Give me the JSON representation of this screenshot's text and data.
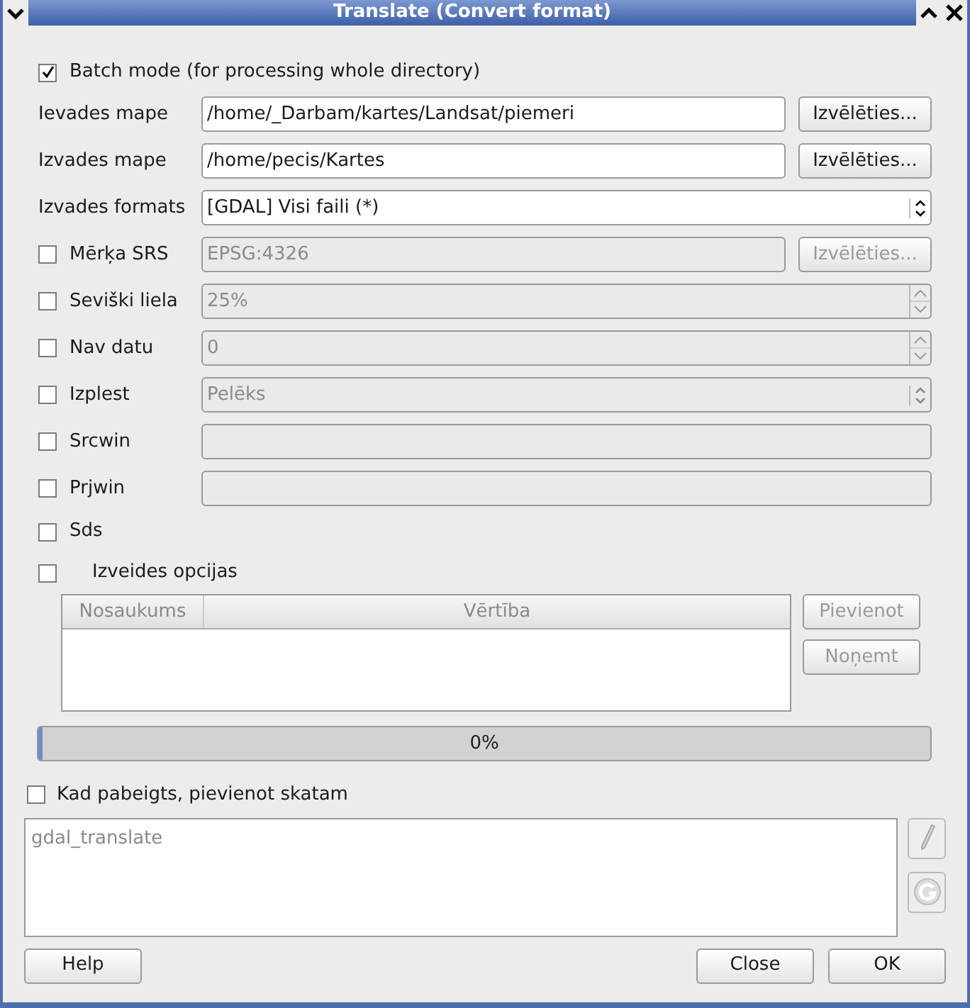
{
  "window": {
    "title": "Translate (Convert format)"
  },
  "batch_mode": {
    "label": "Batch mode (for processing whole directory)",
    "checked": true
  },
  "rows": [
    {
      "kind": "path",
      "label": "Ievades mape",
      "value": "/home/_Darbam/kartes/Landsat/piemeri",
      "button": "Izvēlēties...",
      "disabled": false
    },
    {
      "kind": "path",
      "label": "Izvades mape",
      "value": "/home/pecis/Kartes",
      "button": "Izvēlēties...",
      "disabled": false
    },
    {
      "kind": "combo",
      "label": "Izvades formats",
      "value": "[GDAL] Visi faili (*)",
      "disabled": false
    },
    {
      "kind": "path",
      "label": "Mērķa SRS",
      "checked": false,
      "value": "EPSG:4326",
      "button": "Izvēlēties...",
      "disabled": true
    },
    {
      "kind": "spin",
      "label": "Seviški liela",
      "checked": false,
      "value": "25%",
      "disabled": true
    },
    {
      "kind": "spin",
      "label": "Nav datu",
      "checked": false,
      "value": "0",
      "disabled": true
    },
    {
      "kind": "combo",
      "label": "Izplest",
      "checked": false,
      "value": "Pelēks",
      "disabled": true
    },
    {
      "kind": "text",
      "label": "Srcwin",
      "checked": false,
      "disabled": true
    },
    {
      "kind": "text",
      "label": "Prjwin",
      "checked": false,
      "disabled": true
    },
    {
      "kind": "check",
      "label": "Sds",
      "checked": false
    }
  ],
  "creation_options": {
    "label": "Izveides opcijas",
    "checked": false,
    "columns": [
      "Nosaukums",
      "Vērtība"
    ],
    "buttons": [
      {
        "label": "Pievienot",
        "disabled": true
      },
      {
        "label": "Noņemt",
        "disabled": true
      }
    ]
  },
  "progress": {
    "level": 0,
    "reading": "0%"
  },
  "add_to_view": {
    "label": "Kad pabeigts, pievienot skatam",
    "checked": false
  },
  "command": {
    "value": "gdal_translate"
  },
  "buttons": [
    {
      "label": "Help"
    },
    {
      "label": "Close"
    },
    {
      "label": "OK"
    }
  ]
}
